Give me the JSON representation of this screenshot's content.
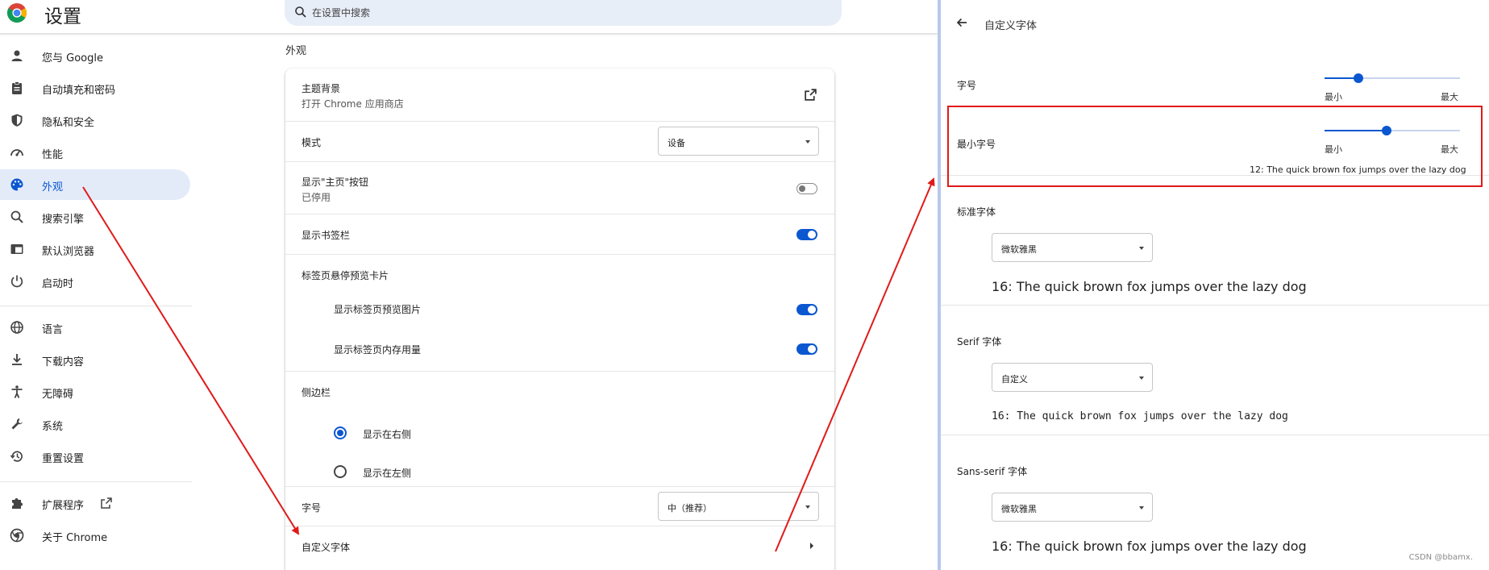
{
  "app": {
    "title": "设置"
  },
  "search": {
    "placeholder": "在设置中搜索"
  },
  "sidebar": {
    "items": [
      {
        "label": "您与 Google",
        "icon": "person-icon"
      },
      {
        "label": "自动填充和密码",
        "icon": "clipboard-icon"
      },
      {
        "label": "隐私和安全",
        "icon": "shield-icon"
      },
      {
        "label": "性能",
        "icon": "speedometer-icon"
      },
      {
        "label": "外观",
        "icon": "palette-icon",
        "active": true
      },
      {
        "label": "搜索引擎",
        "icon": "search-icon"
      },
      {
        "label": "默认浏览器",
        "icon": "browser-window-icon"
      },
      {
        "label": "启动时",
        "icon": "power-icon"
      },
      {
        "label": "语言",
        "icon": "globe-icon"
      },
      {
        "label": "下载内容",
        "icon": "download-icon"
      },
      {
        "label": "无障碍",
        "icon": "accessibility-icon"
      },
      {
        "label": "系统",
        "icon": "wrench-icon"
      },
      {
        "label": "重置设置",
        "icon": "history-icon"
      },
      {
        "label": "扩展程序",
        "icon": "puzzle-icon"
      },
      {
        "label": "关于 Chrome",
        "icon": "chrome-icon"
      }
    ]
  },
  "appearance": {
    "heading": "外观",
    "theme": {
      "title": "主题背景",
      "subtitle": "打开 Chrome 应用商店"
    },
    "mode": {
      "title": "模式",
      "value": "设备"
    },
    "home_button": {
      "title": "显示\"主页\"按钮",
      "subtitle": "已停用",
      "enabled": false
    },
    "bookmarks_bar": {
      "title": "显示书签栏",
      "enabled": true
    },
    "tab_hover": {
      "title": "标签页悬停预览卡片"
    },
    "tab_preview_image": {
      "title": "显示标签页预览图片",
      "enabled": true
    },
    "tab_memory": {
      "title": "显示标签页内存用量",
      "enabled": true
    },
    "side_panel": {
      "title": "侧边栏",
      "options": [
        "显示在右侧",
        "显示在左侧"
      ],
      "selected": 0
    },
    "font_size": {
      "title": "字号",
      "value": "中（推荐）"
    },
    "custom_fonts": {
      "title": "自定义字体"
    }
  },
  "font_panel": {
    "title": "自定义字体",
    "font_size": {
      "label": "字号",
      "min_label": "最小",
      "max_label": "最大",
      "level": 0.25
    },
    "min_font_size": {
      "label": "最小字号",
      "min_label": "最小",
      "max_label": "最大",
      "level": 0.46,
      "sample": "12: The quick brown fox jumps over the lazy dog"
    },
    "standard": {
      "label": "标准字体",
      "value": "微软雅黑",
      "sample": "16: The quick brown fox jumps over the lazy dog"
    },
    "serif": {
      "label": "Serif 字体",
      "value": "自定义",
      "sample": "16: The quick brown fox jumps over the lazy dog"
    },
    "sans_serif": {
      "label": "Sans-serif 字体",
      "value": "微软雅黑",
      "sample": "16: The quick brown fox jumps over the lazy dog"
    }
  },
  "watermark": "CSDN @bbamx.",
  "colors": {
    "accent": "#0b57d0",
    "annotation": "#e01a1a",
    "active_nav_bg": "#e3ebf9"
  }
}
